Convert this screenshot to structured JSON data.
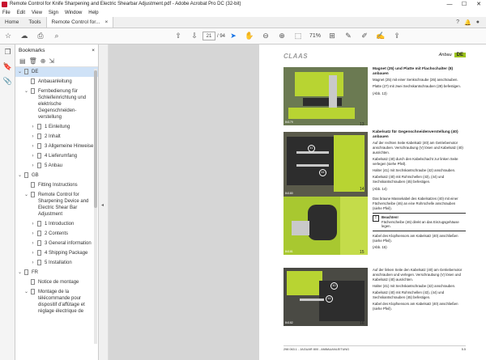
{
  "window": {
    "title": "Remote Control for Knife Sharpening and Electric Shearbar Adjustment.pdf - Adobe Acrobat Pro DC (32-bit)",
    "controls": [
      "—",
      "☐",
      "✕"
    ]
  },
  "menu": [
    "File",
    "Edit",
    "View",
    "Sign",
    "Window",
    "Help"
  ],
  "tabs": {
    "home": "Home",
    "tools": "Tools",
    "doc": "Remote Control for...",
    "doc_close": "×"
  },
  "toolbar": {
    "page_current": "21",
    "page_total": "/ 94",
    "zoom": "71%"
  },
  "panel": {
    "title": "Bookmarks",
    "close": "×",
    "items": [
      {
        "chev": "⌄",
        "indent": 0,
        "label": "DE",
        "selected": true
      },
      {
        "chev": "",
        "indent": 1,
        "label": "Anbauanleitung"
      },
      {
        "chev": "⌄",
        "indent": 1,
        "label": "Fernbedienung für Schleifeinrichtung und elektrische Gegenschneiden-verstellung"
      },
      {
        "chev": "›",
        "indent": 2,
        "label": "1 Einleitung"
      },
      {
        "chev": "›",
        "indent": 2,
        "label": "2 Inhalt"
      },
      {
        "chev": "›",
        "indent": 2,
        "label": "3 Allgemeine Hinweise"
      },
      {
        "chev": "›",
        "indent": 2,
        "label": "4 Lieferumfang"
      },
      {
        "chev": "›",
        "indent": 2,
        "label": "5 Anbau"
      },
      {
        "chev": "⌄",
        "indent": 0,
        "label": "GB"
      },
      {
        "chev": "",
        "indent": 1,
        "label": "Fitting Instructions"
      },
      {
        "chev": "⌄",
        "indent": 1,
        "label": "Remote Control for Sharpening Device and Electric Shear Bar Adjustment"
      },
      {
        "chev": "›",
        "indent": 2,
        "label": "1 Introduction"
      },
      {
        "chev": "›",
        "indent": 2,
        "label": "2 Contents"
      },
      {
        "chev": "›",
        "indent": 2,
        "label": "3 General information"
      },
      {
        "chev": "›",
        "indent": 2,
        "label": "4 Shipping Package"
      },
      {
        "chev": "›",
        "indent": 2,
        "label": "5 Installation"
      },
      {
        "chev": "⌄",
        "indent": 0,
        "label": "FR"
      },
      {
        "chev": "",
        "indent": 1,
        "label": "Notice de montage"
      },
      {
        "chev": "⌄",
        "indent": 1,
        "label": "Montage de la télécommande pour dispositif d'affûtage et réglage électrique de"
      }
    ]
  },
  "page": {
    "logo": "CLAAS",
    "header_section": "Anbau",
    "header_lang": "DE",
    "figures": [
      {
        "code": "84179",
        "num": "13"
      },
      {
        "code": "84180",
        "num": "14"
      },
      {
        "code": "84181",
        "num": "15"
      },
      {
        "code": "84182",
        "num": "16"
      }
    ],
    "blocks": {
      "b1_title": "Magnet (25) und Platte mit Flachschalter (8) anbauen",
      "b1_p1": "Magnet (25) mit einer Senkschraube (26) anschrauben.",
      "b1_p2": "Platte (27) mit zwei Sechskantschrauben (28) befestigen.",
      "b1_p3": "(Abb. 13)",
      "b2_title": "Kabelsatz für Gegenschneidenverstellung (40) anbauen",
      "b2_p1": "Auf der rechten Seite Kabelsatz (40) am Getriebemotor anschrauben. Verschraubung (V) lösen und Kabelsatz (40) ausrichten.",
      "b2_p2": "Kabelsatz (40) durch den Kabelschacht zur linken Seite verlegen (siehe Pfeil).",
      "b2_p3": "Halter (41) mit Sechskantschraube (42) anschrauben.",
      "b2_p4": "Kabelsatz (40) mit Rohrschellen (43), (44) und Sechskantschrauben (45) befestigen.",
      "b2_p5": "(Abb. 14)",
      "b2_p6": "Das braune Massekabel des Kabelsatzes (40) mit einer Fächerscheibe (46) an eine Rohrschelle anschrauben (siehe Pfeil).",
      "note_title": "Beachten!",
      "note_text": "Fächerscheibe (46) direkt an das Einzugsgehäuse legen.",
      "b3_p1": "Kabel des Klopfsensors am Kabelsatz (40) anschließen (siehe Pfeil).",
      "b3_p2": "(Abb. 15)",
      "b4_p1": "Auf der linken Seite den Kabelsatz (40) am Getriebemotor anschrauben und verlegen. Verschraubung (V) lösen und Kabelsatz (40) ausrichten.",
      "b4_p2": "Halter (41) mit Sechskantschraube (42) anschrauben.",
      "b4_p3": "Kabelsatz (40) mit Rohrschellen (43), (44) und Sechskantschrauben (45) befestigen.",
      "b4_p4": "Kabel des Klopfsensors am Kabelsatz (40) anschließen (siehe Pfeil)."
    },
    "footer_left": "298 063.1 - JAGUAR 800 - ANBAUANLEITUNG",
    "footer_right": "5.5"
  },
  "colors": {
    "accent": "#1473e6",
    "claas_green": "#9dc31b",
    "selection": "#cfe2f7"
  }
}
